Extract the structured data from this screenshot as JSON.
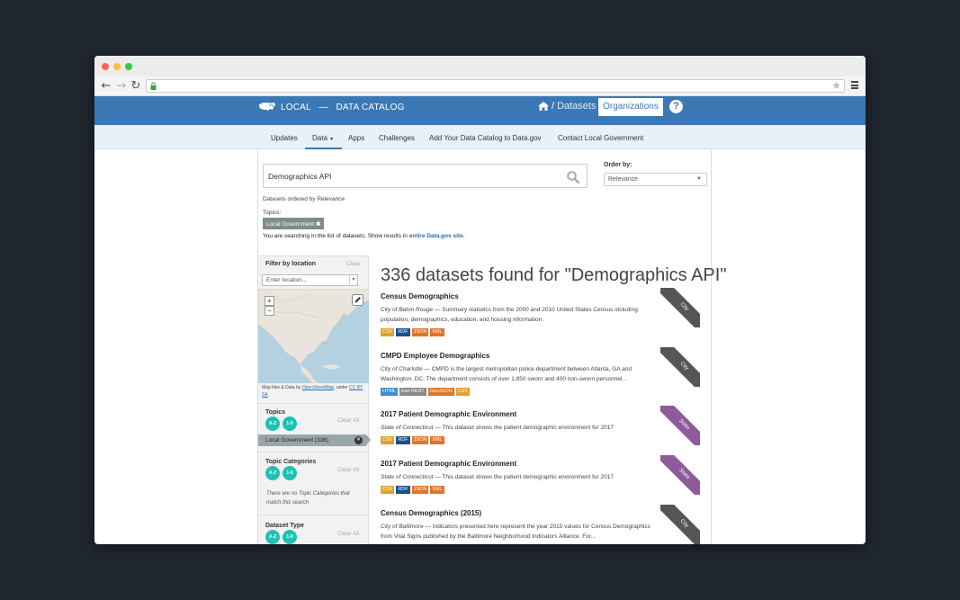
{
  "header": {
    "brand_local": "LOCAL",
    "brand_sep": "—",
    "brand_catalog": "DATA CATALOG",
    "crumb_sep": "/",
    "crumb_datasets": "Datasets",
    "organizations": "Organizations",
    "help": "?"
  },
  "nav": {
    "items": [
      "Updates",
      "Data",
      "Apps",
      "Challenges",
      "Add Your Data Catalog to Data.gov",
      "Contact Local Government"
    ],
    "active_index": 1
  },
  "search": {
    "query": "Demographics API",
    "order_label": "Order by:",
    "order_value": "Relevance",
    "ordered_by": "Datasets ordered by Relevance",
    "topics_label": "Topics:",
    "topic_tag": "Local Government",
    "note_prefix": "You are searching in the list of datasets. Show results in",
    "note_link": "entire Data.gov site."
  },
  "sidebar": {
    "location_title": "Filter by location",
    "location_clear": "Clear",
    "location_placeholder": "Enter location...",
    "map_attr_prefix": "Map tiles & Data by",
    "map_attr_link": "OpenStreetMap",
    "map_attr_suffix": ", under",
    "map_attr_license": "CC BY SA",
    "topics_title": "Topics",
    "topics_clear": "Clear All",
    "topics_active": "Local Government (336)",
    "categories_title": "Topic Categories",
    "categories_clear": "Clear All",
    "categories_empty": "There are no Topic Categories that match this search",
    "dataset_type_title": "Dataset Type",
    "dataset_type_clear": "Clear All",
    "sort_az": "A-Z",
    "sort_19": "1-9"
  },
  "results": {
    "heading": "336 datasets found for \"Demographics API\"",
    "items": [
      {
        "title": "Census Demographics",
        "publisher": "City of Baton Rouge",
        "description": "— Summary statistics from the 2000 and 2010 United States Census including population, demographics, education, and housing information.",
        "formats": [
          "CSV",
          "RDF",
          "JSON",
          "XML"
        ],
        "ribbon": "City"
      },
      {
        "title": "CMPD Employee Demographics",
        "publisher": "City of Charlotte",
        "description": "— CMPD is the largest metropolitan police department between Atlanta, GA and Washington, DC. The department consists of over 1,850 sworn and 400 non-sworn personnel...",
        "formats": [
          "HTML",
          "Esri REST",
          "GeoJSON",
          "CSV"
        ],
        "ribbon": "City"
      },
      {
        "title": "2017 Patient Demographic Environment",
        "publisher": "State of Connecticut",
        "description": "— This dataset shows the patient demographic environment for 2017",
        "formats": [
          "CSV",
          "RDF",
          "JSON",
          "XML"
        ],
        "ribbon": "State"
      },
      {
        "title": "2017 Patient Demographic Environment",
        "publisher": "State of Connecticut",
        "description": "— This dataset shows the patient demographic environment for 2017",
        "formats": [
          "CSV",
          "RDF",
          "JSON",
          "XML"
        ],
        "ribbon": "State"
      },
      {
        "title": "Census Demographics (2015)",
        "publisher": "City of Baltimore",
        "description": "— Indicators presented here represent the year 2015 values for Census Demographics from Vital Signs published by the Baltimore Neighborhood Indicators Alliance. For...",
        "formats": [],
        "ribbon": "City"
      }
    ]
  },
  "colors": {
    "header_blue": "#3a78b6",
    "city_ribbon": "#555555",
    "state_ribbon": "#8e5a9a",
    "format_colors": {
      "CSV": "#dfa22f",
      "RDF": "#1b4f8a",
      "JSON": "#e0762b",
      "XML": "#e0762b",
      "HTML": "#3d8fd1",
      "Esri REST": "#8a8a8a",
      "GeoJSON": "#e0762b"
    }
  },
  "icons": [
    "us-map-logo-icon",
    "home-icon",
    "help-icon",
    "search-icon",
    "lock-icon",
    "star-icon",
    "menu-icon",
    "edit-icon",
    "close-icon"
  ]
}
